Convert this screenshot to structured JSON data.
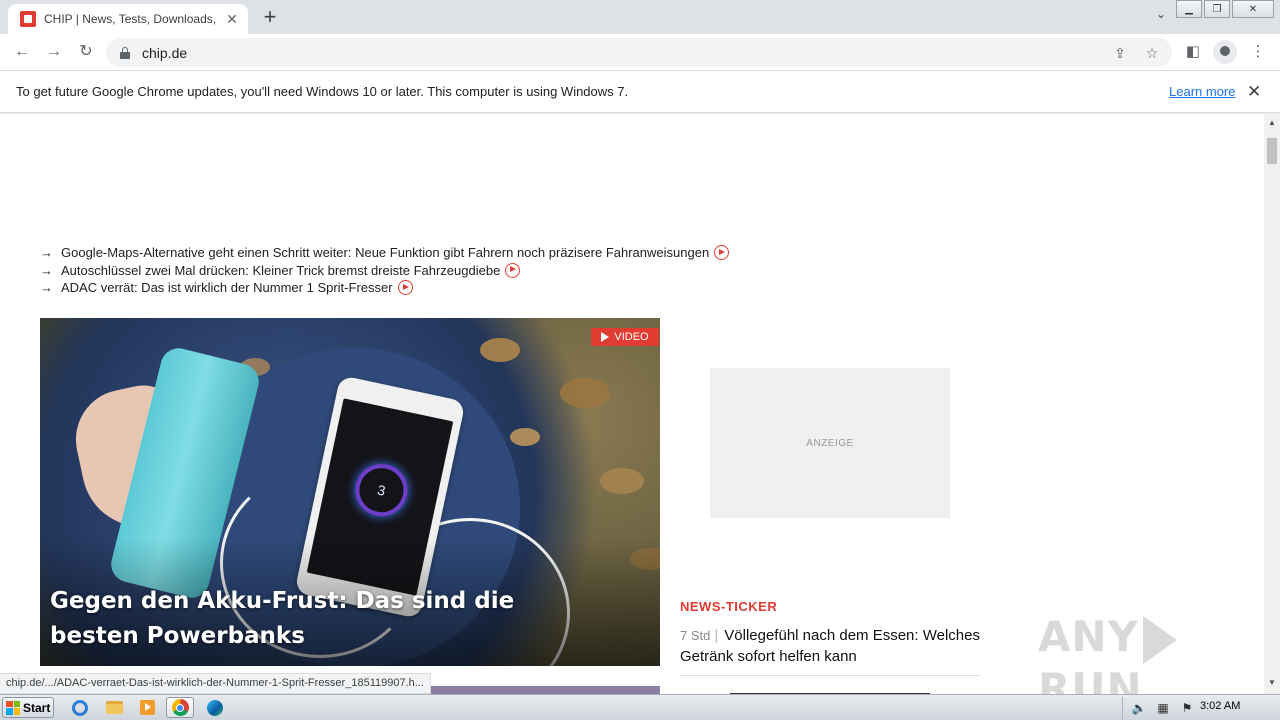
{
  "browser": {
    "tab": {
      "title": "CHIP | News, Tests, Downloads, Tech",
      "favicon_color": "#e03c31"
    },
    "newtab_symbol": "+",
    "tab_search_symbol": "⌄",
    "window_buttons": [
      "minimize",
      "restore",
      "close"
    ],
    "url": "chip.de",
    "infobar": {
      "message": "To get future Google Chrome updates, you'll need Windows 10 or later. This computer is using Windows 7.",
      "link": "Learn more"
    }
  },
  "page": {
    "headlines": [
      {
        "text": "Google-Maps-Alternative geht einen Schritt weiter: Neue Funktion gibt Fahrern noch präzisere Fahranweisungen"
      },
      {
        "text": "Autoschlüssel zwei Mal drücken: Kleiner Trick bremst dreiste Fahrzeugdiebe"
      },
      {
        "text": "ADAC verrät: Das ist wirklich der Nummer 1 Sprit-Fresser"
      }
    ],
    "headline_arrow": "→",
    "hero": {
      "badge": "VIDEO",
      "title": "Gegen den Akku-Frust: Das sind die besten Powerbanks",
      "phone_screen_text": "3"
    },
    "ad_label": "ANZEIGE",
    "news_ticker": {
      "label": "NEWS-TICKER",
      "items": [
        {
          "time": "7 Std",
          "separator": "|",
          "title": "Völlegefühl nach dem Essen: Welches Getränk sofort helfen kann"
        }
      ]
    },
    "accent_color": "#e03c31"
  },
  "status_url": "chip.de/.../ADAC-verraet-Das-ist-wirklich-der-Nummer-1-Sprit-Fresser_185119907.h...",
  "watermark": {
    "left": "ANY",
    "right": "RUN"
  },
  "taskbar": {
    "start_label": "Start",
    "apps": [
      "internet-explorer",
      "file-explorer",
      "media-player",
      "chrome",
      "edge"
    ],
    "clock": "3:02 AM"
  }
}
